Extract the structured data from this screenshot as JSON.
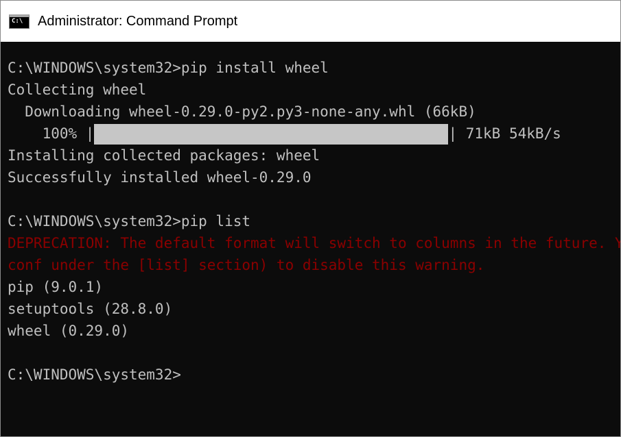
{
  "window": {
    "title": "Administrator: Command Prompt",
    "icon": "cmd-icon",
    "icon_glyph": "C:\\"
  },
  "console": {
    "lines": [
      "C:\\WINDOWS\\system32>pip install wheel",
      "Collecting wheel",
      "  Downloading wheel-0.29.0-py2.py3-none-any.whl (66kB)",
      "",
      "Installing collected packages: wheel",
      "Successfully installed wheel-0.29.0",
      "",
      "C:\\WINDOWS\\system32>pip list",
      "DEPRECATION: The default format will switch to columns in the future. You can use --format=(legacy|columns) (or define a format=(legacy|columns) in your pip.conf under the [list] section) to disable this warning.",
      "conf under the [list] section) to disable this warning.",
      "pip (9.0.1)",
      "setuptools (28.8.0)",
      "wheel (0.29.0)",
      "",
      "C:\\WINDOWS\\system32>"
    ],
    "progress": {
      "prefix": "    100% |",
      "fraction": 1.0,
      "suffix": "| 71kB 54kB/s"
    }
  },
  "colors": {
    "background": "#0c0c0c",
    "text": "#c0c0c0",
    "error_text": "#8b0000",
    "progress_fill": "#c6c6c6"
  }
}
